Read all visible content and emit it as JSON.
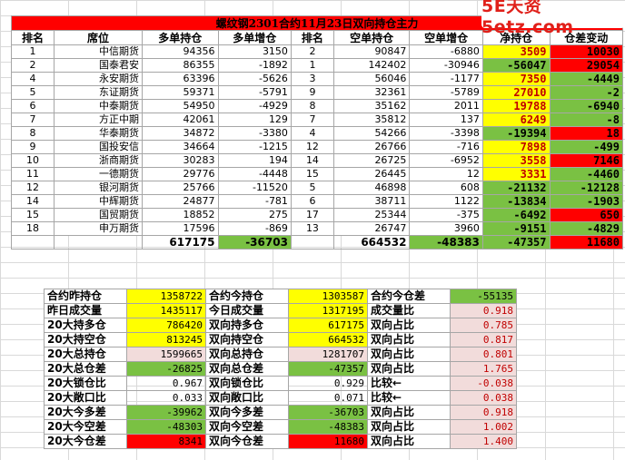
{
  "title": "螺纹钢2301合约11月23日双向持仓主力",
  "watermark": "5E天资5etz.com",
  "headers": [
    "排名",
    "席位",
    "多单持仓",
    "多单增仓",
    "排名",
    "空单持仓",
    "空单增仓",
    "净持仓",
    "仓差变动"
  ],
  "rows": [
    {
      "rank": "1",
      "name": "中信期货",
      "long": "94356",
      "long_chg": "3150",
      "srank": "2",
      "short": "90847",
      "short_chg": "-6880",
      "net": "3509",
      "net_color": "yellow",
      "diff": "10030",
      "diff_color": "red"
    },
    {
      "rank": "2",
      "name": "国泰君安",
      "long": "86355",
      "long_chg": "-1892",
      "srank": "1",
      "short": "142402",
      "short_chg": "-30946",
      "net": "-56047",
      "net_color": "green",
      "diff": "29054",
      "diff_color": "red"
    },
    {
      "rank": "4",
      "name": "永安期货",
      "long": "63396",
      "long_chg": "-5626",
      "srank": "3",
      "short": "56046",
      "short_chg": "-1177",
      "net": "7350",
      "net_color": "yellow",
      "diff": "-4449",
      "diff_color": "green"
    },
    {
      "rank": "5",
      "name": "东证期货",
      "long": "59371",
      "long_chg": "-5791",
      "srank": "9",
      "short": "32361",
      "short_chg": "-5789",
      "net": "27010",
      "net_color": "yellow",
      "diff": "-2",
      "diff_color": "green"
    },
    {
      "rank": "6",
      "name": "中泰期货",
      "long": "54950",
      "long_chg": "-4929",
      "srank": "8",
      "short": "35162",
      "short_chg": "2011",
      "net": "19788",
      "net_color": "yellow",
      "diff": "-6940",
      "diff_color": "green"
    },
    {
      "rank": "7",
      "name": "方正中期",
      "long": "42061",
      "long_chg": "129",
      "srank": "7",
      "short": "35812",
      "short_chg": "137",
      "net": "6249",
      "net_color": "yellow",
      "diff": "-8",
      "diff_color": "green"
    },
    {
      "rank": "8",
      "name": "华泰期货",
      "long": "34872",
      "long_chg": "-3380",
      "srank": "4",
      "short": "54266",
      "short_chg": "-3398",
      "net": "-19394",
      "net_color": "green",
      "diff": "18",
      "diff_color": "red"
    },
    {
      "rank": "9",
      "name": "国投安信",
      "long": "34664",
      "long_chg": "-1215",
      "srank": "12",
      "short": "26766",
      "short_chg": "-716",
      "net": "7898",
      "net_color": "yellow",
      "diff": "-499",
      "diff_color": "green"
    },
    {
      "rank": "10",
      "name": "浙商期货",
      "long": "30283",
      "long_chg": "194",
      "srank": "14",
      "short": "26725",
      "short_chg": "-6952",
      "net": "3558",
      "net_color": "yellow",
      "diff": "7146",
      "diff_color": "red"
    },
    {
      "rank": "11",
      "name": "一德期货",
      "long": "29776",
      "long_chg": "-4448",
      "srank": "15",
      "short": "26445",
      "short_chg": "12",
      "net": "3331",
      "net_color": "yellow",
      "diff": "-4460",
      "diff_color": "green"
    },
    {
      "rank": "12",
      "name": "银河期货",
      "long": "25766",
      "long_chg": "-11520",
      "srank": "5",
      "short": "46898",
      "short_chg": "608",
      "net": "-21132",
      "net_color": "green",
      "diff": "-12128",
      "diff_color": "green"
    },
    {
      "rank": "14",
      "name": "中辉期货",
      "long": "24877",
      "long_chg": "-781",
      "srank": "6",
      "short": "38711",
      "short_chg": "1122",
      "net": "-13834",
      "net_color": "green",
      "diff": "-1903",
      "diff_color": "green"
    },
    {
      "rank": "15",
      "name": "国贸期货",
      "long": "18852",
      "long_chg": "275",
      "srank": "17",
      "short": "25344",
      "short_chg": "-375",
      "net": "-6492",
      "net_color": "green",
      "diff": "650",
      "diff_color": "red"
    },
    {
      "rank": "18",
      "name": "申万期货",
      "long": "17596",
      "long_chg": "-869",
      "srank": "13",
      "short": "26747",
      "short_chg": "3960",
      "net": "-9151",
      "net_color": "green",
      "diff": "-4829",
      "diff_color": "green"
    }
  ],
  "totals": {
    "long": "617175",
    "long_chg": "-36703",
    "short": "664532",
    "short_chg": "-48383",
    "net": "-47357",
    "diff": "11680"
  },
  "summary": [
    {
      "l1": "合约昨持仓",
      "v1": "1358722",
      "c1": "yellow",
      "l2": "合约今持仓",
      "v2": "1303587",
      "c2": "yellow",
      "l3": "合约今仓差",
      "v3": "-55135",
      "c3": "green"
    },
    {
      "l1": "昨日成交量",
      "v1": "1435117",
      "c1": "yellow",
      "l2": "今日成交量",
      "v2": "1317195",
      "c2": "yellow",
      "l3": "成交量比",
      "v3": "0.918",
      "c3": "pink"
    },
    {
      "l1": "20大持多仓",
      "v1": "786420",
      "c1": "yellow",
      "l2": "双向持多仓",
      "v2": "617175",
      "c2": "yellow",
      "l3": "双向占比",
      "v3": "0.785",
      "c3": "pink"
    },
    {
      "l1": "20大持空仓",
      "v1": "813245",
      "c1": "yellow",
      "l2": "双向持空仓",
      "v2": "664532",
      "c2": "yellow",
      "l3": "双向占比",
      "v3": "0.817",
      "c3": "pink"
    },
    {
      "l1": "20大总持仓",
      "v1": "1599665",
      "c1": "pink",
      "l2": "双向总持仓",
      "v2": "1281707",
      "c2": "pink",
      "l3": "双向占比",
      "v3": "0.801",
      "c3": "pink"
    },
    {
      "l1": "20大总仓差",
      "v1": "-26825",
      "c1": "green",
      "l2": "双向总仓差",
      "v2": "-47357",
      "c2": "green",
      "l3": "双向占比",
      "v3": "1.765",
      "c3": "pink"
    },
    {
      "l1": "20大锁仓比",
      "v1": "0.967",
      "c1": "white",
      "l2": "双向锁仓比",
      "v2": "0.929",
      "c2": "white",
      "l3": "比较←",
      "v3": "-0.038",
      "c3": "pink"
    },
    {
      "l1": "20大敞口比",
      "v1": "0.033",
      "c1": "white",
      "l2": "双向敞口比",
      "v2": "0.071",
      "c2": "white",
      "l3": "比较←",
      "v3": "0.038",
      "c3": "pink"
    },
    {
      "l1": "20大今多差",
      "v1": "-39962",
      "c1": "green",
      "l2": "双向今多差",
      "v2": "-36703",
      "c2": "green",
      "l3": "双向占比",
      "v3": "0.918",
      "c3": "pink"
    },
    {
      "l1": "20大今空差",
      "v1": "-48303",
      "c1": "green",
      "l2": "双向今空差",
      "v2": "-48383",
      "c2": "green",
      "l3": "双向占比",
      "v3": "1.002",
      "c3": "pink"
    },
    {
      "l1": "20大今仓差",
      "v1": "8341",
      "c1": "red",
      "l2": "双向今仓差",
      "v2": "11680",
      "c2": "red",
      "l3": "双向占比",
      "v3": "1.400",
      "c3": "pink"
    }
  ]
}
